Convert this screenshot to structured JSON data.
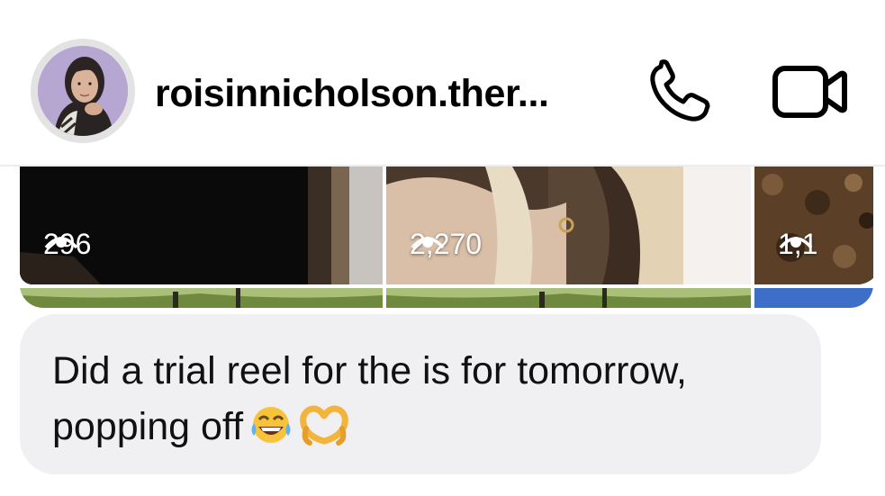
{
  "header": {
    "username": "roisinnicholson.ther...",
    "avatar_icon": "profile-photo",
    "call_icon": "phone-icon",
    "video_icon": "video-camera-icon"
  },
  "media": {
    "tiles": [
      {
        "views": "296"
      },
      {
        "views": "2,270"
      },
      {
        "views": "1,1"
      }
    ]
  },
  "message": {
    "text": "Did a trial reel for the is for tomorrow, popping off",
    "emojis": [
      "face-with-tears-of-joy",
      "heart-hands"
    ]
  },
  "colors": {
    "bubble": "#f0f0f2",
    "text": "#111111",
    "accent_strip": "#3d6fc8"
  }
}
